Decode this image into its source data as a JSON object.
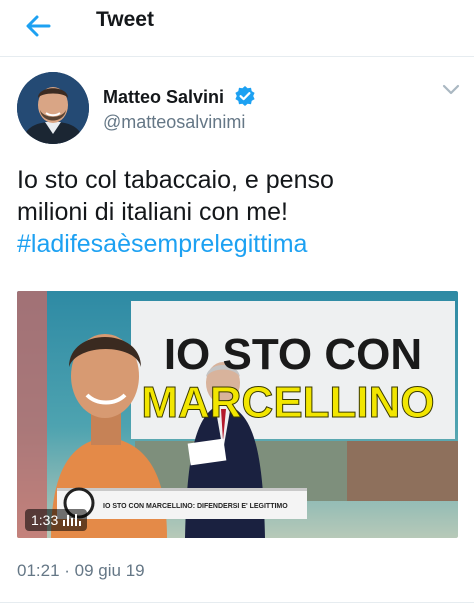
{
  "header": {
    "back_icon": "arrow-left-icon",
    "title": "Tweet",
    "accent": "#1da1f2"
  },
  "author": {
    "name": "Matteo Salvini",
    "handle": "@matteosalvinimi",
    "verified_icon": "verified-badge-icon",
    "menu_icon": "chevron-down-icon"
  },
  "tweet": {
    "text_line1": "Io sto col tabaccaio, e penso",
    "text_line2": "milioni di italiani con me!",
    "hashtag": "#ladifesaèsemprelegittima",
    "timestamp": "01:21 · 09 giu 19"
  },
  "video": {
    "duration": "1:33",
    "headline_line1": "IO STO CON",
    "headline_line2": "MARCELLINO",
    "ticker": "IO STO CON MARCELLINO: DIFENDERSI E' LEGITTIMO",
    "colors": {
      "headline_yellow": "#f2e600",
      "ticker_band": "#f4f4f4"
    }
  }
}
